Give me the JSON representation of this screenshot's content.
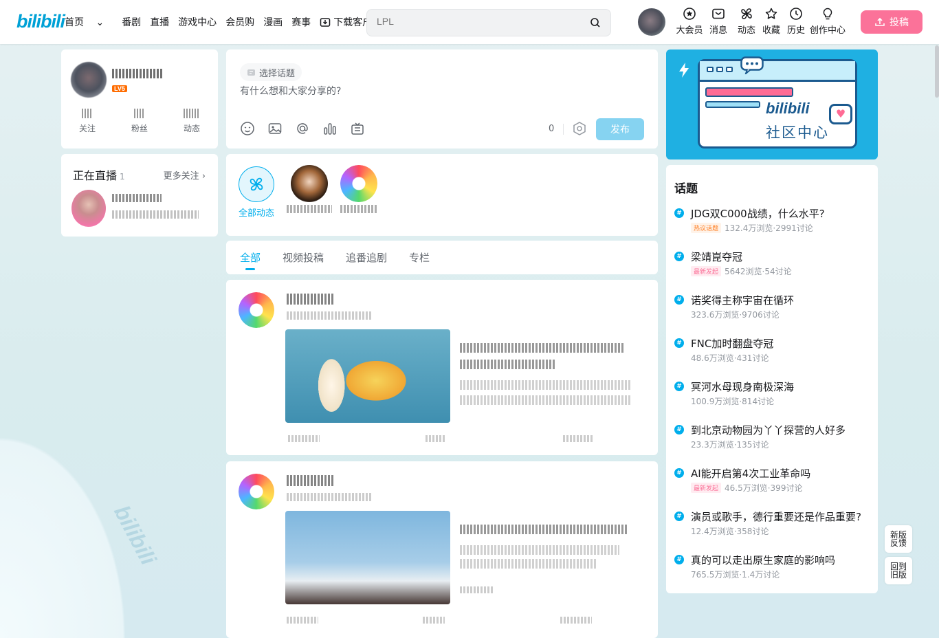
{
  "header": {
    "logo": "bilibili",
    "nav": [
      "首页",
      "番剧",
      "直播",
      "游戏中心",
      "会员购",
      "漫画",
      "赛事"
    ],
    "download": "下载客户端",
    "search_placeholder": "LPL",
    "icons": [
      {
        "label": "大会员",
        "icon": "vip-icon"
      },
      {
        "label": "消息",
        "icon": "message-icon"
      },
      {
        "label": "动态",
        "icon": "dynamic-icon"
      },
      {
        "label": "收藏",
        "icon": "favorite-icon"
      },
      {
        "label": "历史",
        "icon": "history-icon"
      },
      {
        "label": "创作中心",
        "icon": "creator-icon"
      }
    ],
    "upload": "投稿"
  },
  "user": {
    "level": "LV5",
    "stats": [
      "关注",
      "粉丝",
      "动态"
    ]
  },
  "live": {
    "title": "正在直播",
    "count": "1",
    "more": "更多关注"
  },
  "publish": {
    "topic": "选择话题",
    "placeholder": "有什么想和大家分享的?",
    "count": "0",
    "send": "发布"
  },
  "ups": {
    "all_label": "全部动态"
  },
  "tabs": [
    "全部",
    "视频投稿",
    "追番追剧",
    "专栏"
  ],
  "banner": {
    "logo": "bilibili",
    "title": "社区中心"
  },
  "topics": {
    "title": "话题",
    "items": [
      {
        "name": "JDG双C000战绩，什么水平?",
        "badge": "热议话题",
        "badge_type": "hot",
        "meta": "132.4万浏览·2991讨论"
      },
      {
        "name": "梁靖崑夺冠",
        "badge": "最新发起",
        "badge_type": "new",
        "meta": "5642浏览·54讨论"
      },
      {
        "name": "诺奖得主称宇宙在循环",
        "badge": "",
        "badge_type": "",
        "meta": "323.6万浏览·9706讨论"
      },
      {
        "name": "FNC加时翻盘夺冠",
        "badge": "",
        "badge_type": "",
        "meta": "48.6万浏览·431讨论"
      },
      {
        "name": "冥河水母现身南极深海",
        "badge": "",
        "badge_type": "",
        "meta": "100.9万浏览·814讨论"
      },
      {
        "name": "到北京动物园为丫丫探营的人好多",
        "badge": "",
        "badge_type": "",
        "meta": "23.3万浏览·135讨论"
      },
      {
        "name": "AI能开启第4次工业革命吗",
        "badge": "最新发起",
        "badge_type": "new",
        "meta": "46.5万浏览·399讨论"
      },
      {
        "name": "演员或歌手，德行重要还是作品重要?",
        "badge": "",
        "badge_type": "",
        "meta": "12.4万浏览·358讨论"
      },
      {
        "name": "真的可以走出原生家庭的影响吗",
        "badge": "",
        "badge_type": "",
        "meta": "765.5万浏览·1.4万讨论"
      }
    ]
  },
  "side": {
    "new_version": "新版反馈",
    "old_version": "回到旧版"
  },
  "watermark": "bilibili"
}
